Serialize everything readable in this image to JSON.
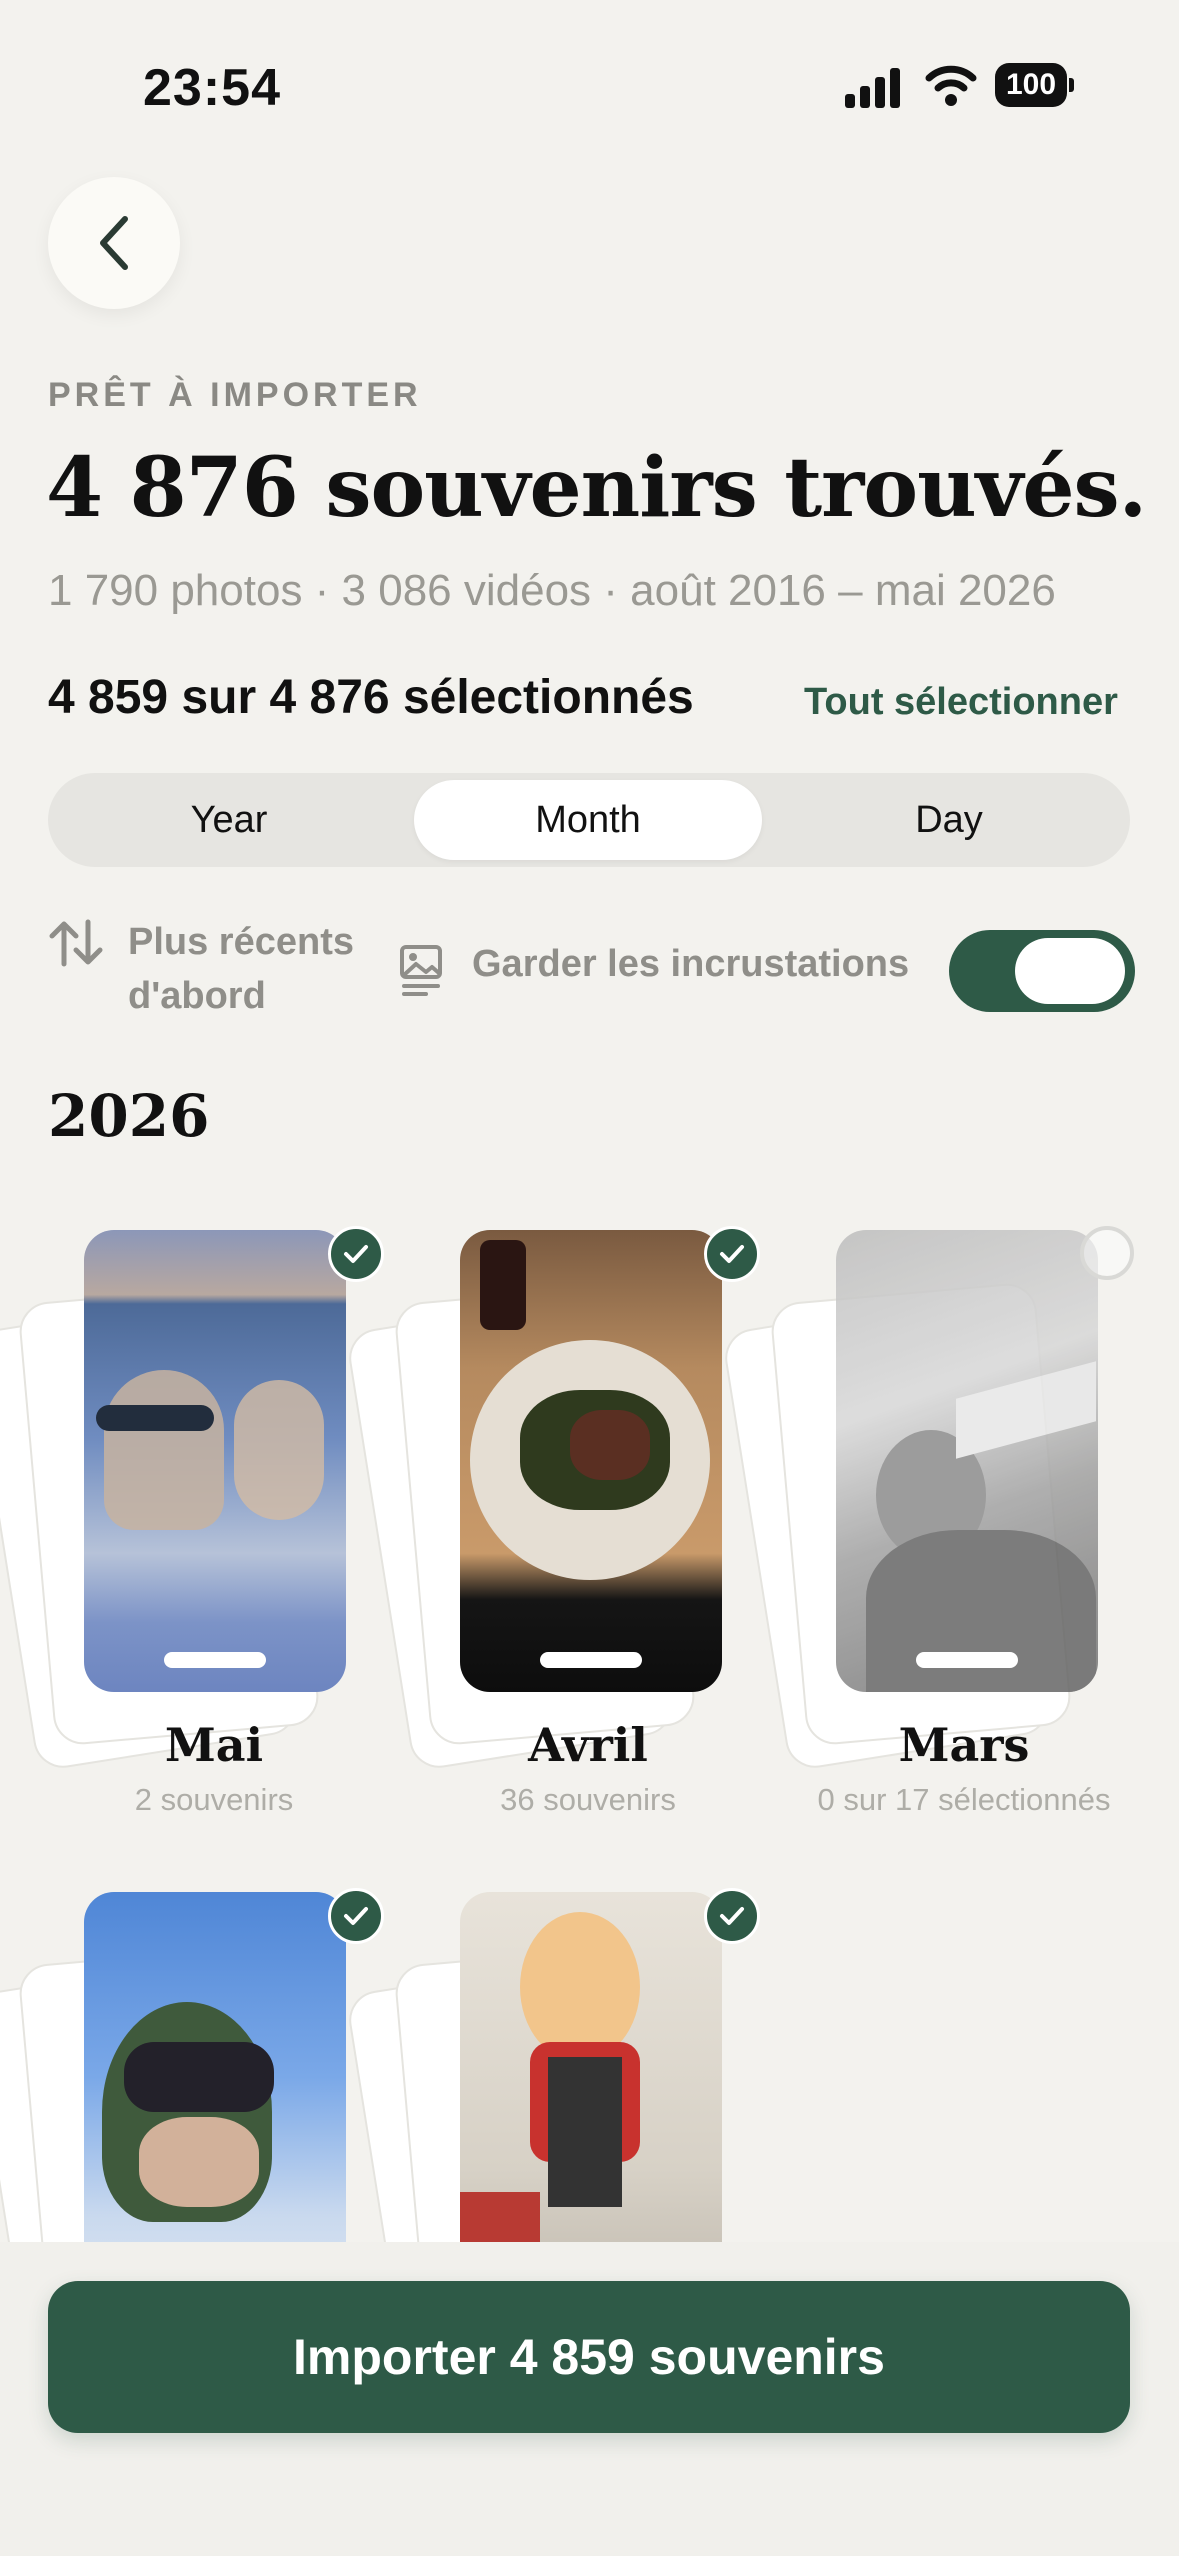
{
  "status_bar": {
    "time": "23:54",
    "battery": "100"
  },
  "header": {
    "eyebrow": "PRÊT À IMPORTER",
    "title": "4 876 souvenirs trouvés.",
    "subtitle": "1 790 photos · 3 086 vidéos · août 2016 – mai 2026"
  },
  "selection": {
    "count_label": "4 859 sur 4 876 sélectionnés",
    "select_all": "Tout sélectionner"
  },
  "segmented": {
    "options": [
      "Year",
      "Month",
      "Day"
    ],
    "active": "Month"
  },
  "options": {
    "sort_line1": "Plus récents",
    "sort_line2": "d'abord",
    "overlay_label": "Garder les incrustations",
    "overlay_enabled": true
  },
  "year_heading": "2026",
  "months": [
    {
      "name": "Mai",
      "count": "2 souvenirs",
      "selected": true
    },
    {
      "name": "Avril",
      "count": "36 souvenirs",
      "selected": true
    },
    {
      "name": "Mars",
      "count": "0 sur 17 sélectionnés",
      "selected": false
    },
    {
      "name": "",
      "count": "",
      "selected": true
    },
    {
      "name": "",
      "count": "",
      "selected": true
    }
  ],
  "import_button": "Importer 4 859 souvenirs",
  "colors": {
    "accent": "#2e5a47",
    "background": "#f3f2ee"
  }
}
